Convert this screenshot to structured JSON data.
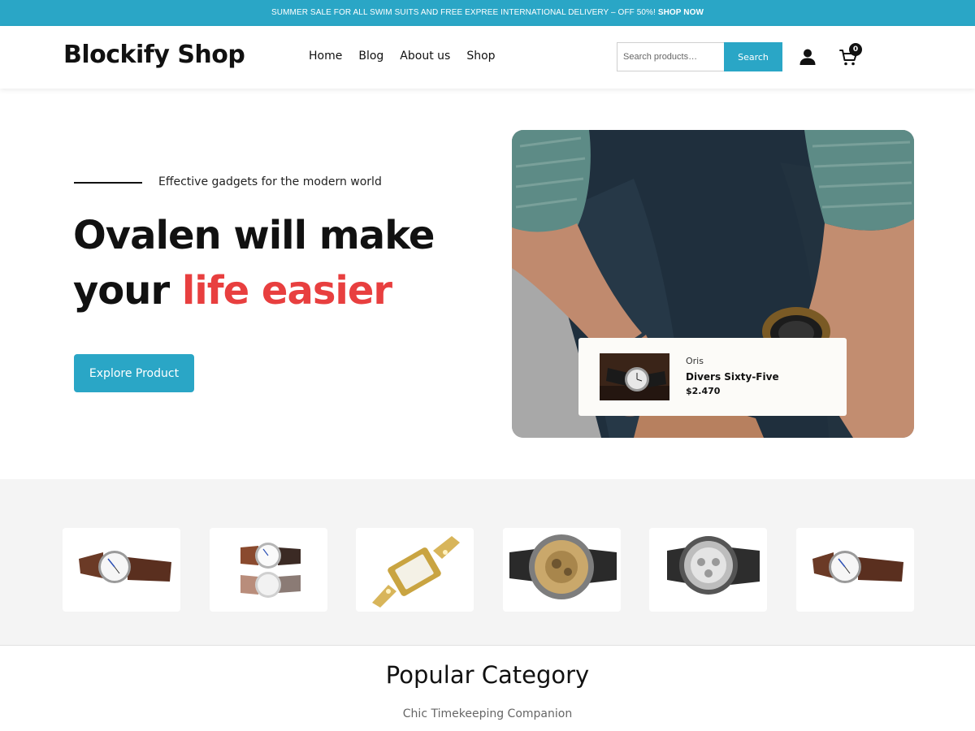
{
  "announcement": {
    "text": "SUMMER SALE FOR ALL SWIM SUITS AND FREE EXPREE INTERNATIONAL DELIVERY – OFF 50%! ",
    "cta": "SHOP NOW"
  },
  "header": {
    "logo": "Blockify Shop",
    "nav": [
      "Home",
      "Blog",
      "About us",
      "Shop"
    ],
    "search": {
      "placeholder": "Search products…",
      "button": "Search"
    },
    "cart_count": "0",
    "icons": {
      "account": "user-icon",
      "cart": "cart-icon"
    }
  },
  "hero": {
    "tagline": "Effective gadgets for the modern world",
    "title_line1": "Ovalen will make",
    "title_line2_prefix": "your ",
    "title_line2_accent": "life easier",
    "cta": "Explore Product",
    "accent_color": "#e83f3f",
    "featured_product": {
      "brand": "Oris",
      "name": "Divers Sixty-Five",
      "price": "$2.470"
    }
  },
  "watches": [
    {
      "name": "watch-brown-leather-white-dial"
    },
    {
      "name": "watch-brown-leather-reflection"
    },
    {
      "name": "watch-gold-bracelet"
    },
    {
      "name": "watch-skeleton-black-strap"
    },
    {
      "name": "watch-chronograph-black-strap"
    },
    {
      "name": "watch-brown-leather-white-dial-2"
    }
  ],
  "popular_category": {
    "title": "Popular Category",
    "subtitle": "Chic Timekeeping Companion"
  },
  "colors": {
    "primary": "#2aa6c6",
    "accent": "#e83f3f",
    "text": "#111111",
    "strip_bg": "#f4f4f4"
  }
}
